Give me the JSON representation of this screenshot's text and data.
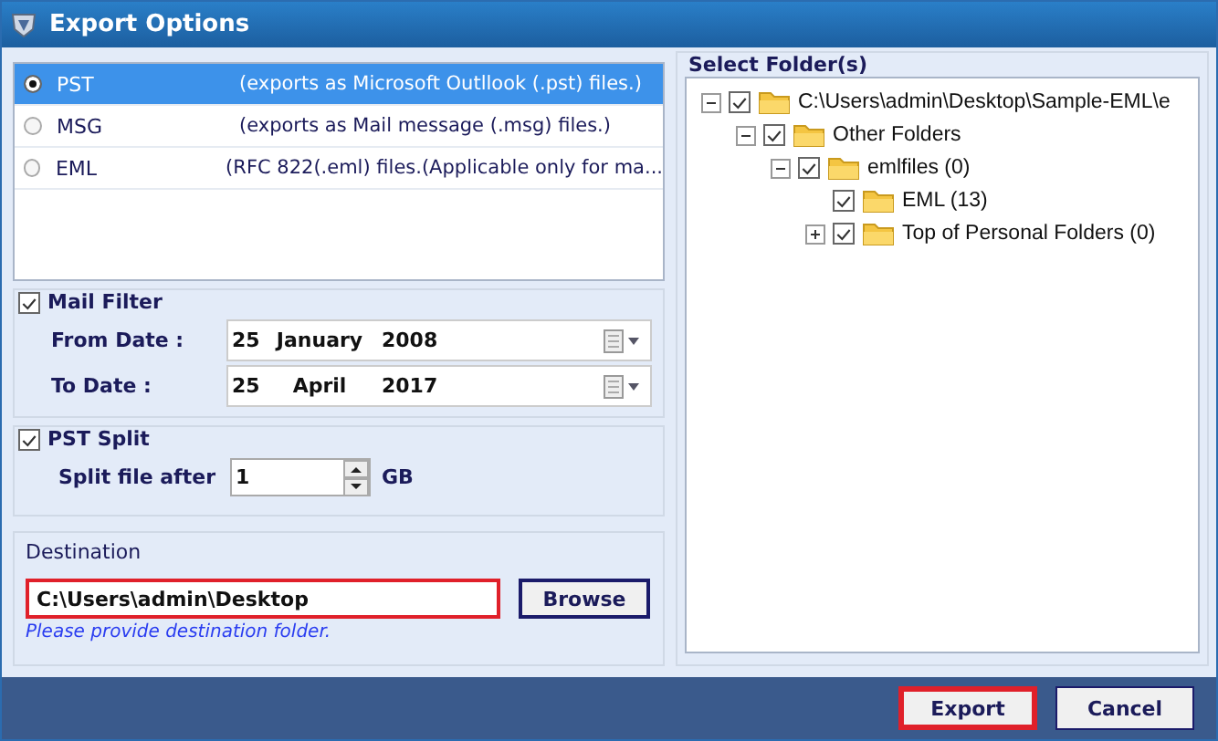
{
  "window": {
    "title": "Export Options"
  },
  "formats": [
    {
      "name": "PST",
      "description": "(exports as Microsoft Outllook (.pst) files.)",
      "selected": true
    },
    {
      "name": "MSG",
      "description": "(exports as Mail message (.msg) files.)",
      "selected": false
    },
    {
      "name": "EML",
      "description": "(RFC 822(.eml) files.(Applicable only for ma...",
      "selected": false
    }
  ],
  "mail_filter": {
    "label": "Mail Filter",
    "checked": true,
    "dates": [
      {
        "label": "From Date :",
        "day": "25",
        "month": "January",
        "year": "2008"
      },
      {
        "label": "To Date :",
        "day": "25",
        "month": "April",
        "year": "2017"
      }
    ]
  },
  "pst_split": {
    "label": "PST Split",
    "checked": true,
    "field_label": "Split file after",
    "value": "1",
    "unit": "GB"
  },
  "destination": {
    "label": "Destination",
    "value": "C:\\Users\\admin\\Desktop",
    "error": true,
    "hint": "Please provide destination folder.",
    "browse": "Browse"
  },
  "folders": {
    "label": "Select Folder(s)",
    "tree": [
      {
        "label": "C:\\Users\\admin\\Desktop\\Sample-EML\\e",
        "checked": true,
        "expanded": true,
        "children": [
          {
            "label": "Other Folders",
            "checked": true,
            "expanded": true,
            "children": [
              {
                "label": "emlfiles (0)",
                "checked": true,
                "expanded": true,
                "children": [
                  {
                    "label": "EML (13)",
                    "checked": true
                  },
                  {
                    "label": "Top of Personal Folders (0)",
                    "checked": true,
                    "expanded": false
                  }
                ]
              }
            ]
          }
        ]
      }
    ]
  },
  "buttons": [
    {
      "label": "Export",
      "focused": true
    },
    {
      "label": "Cancel",
      "focused": false
    }
  ]
}
